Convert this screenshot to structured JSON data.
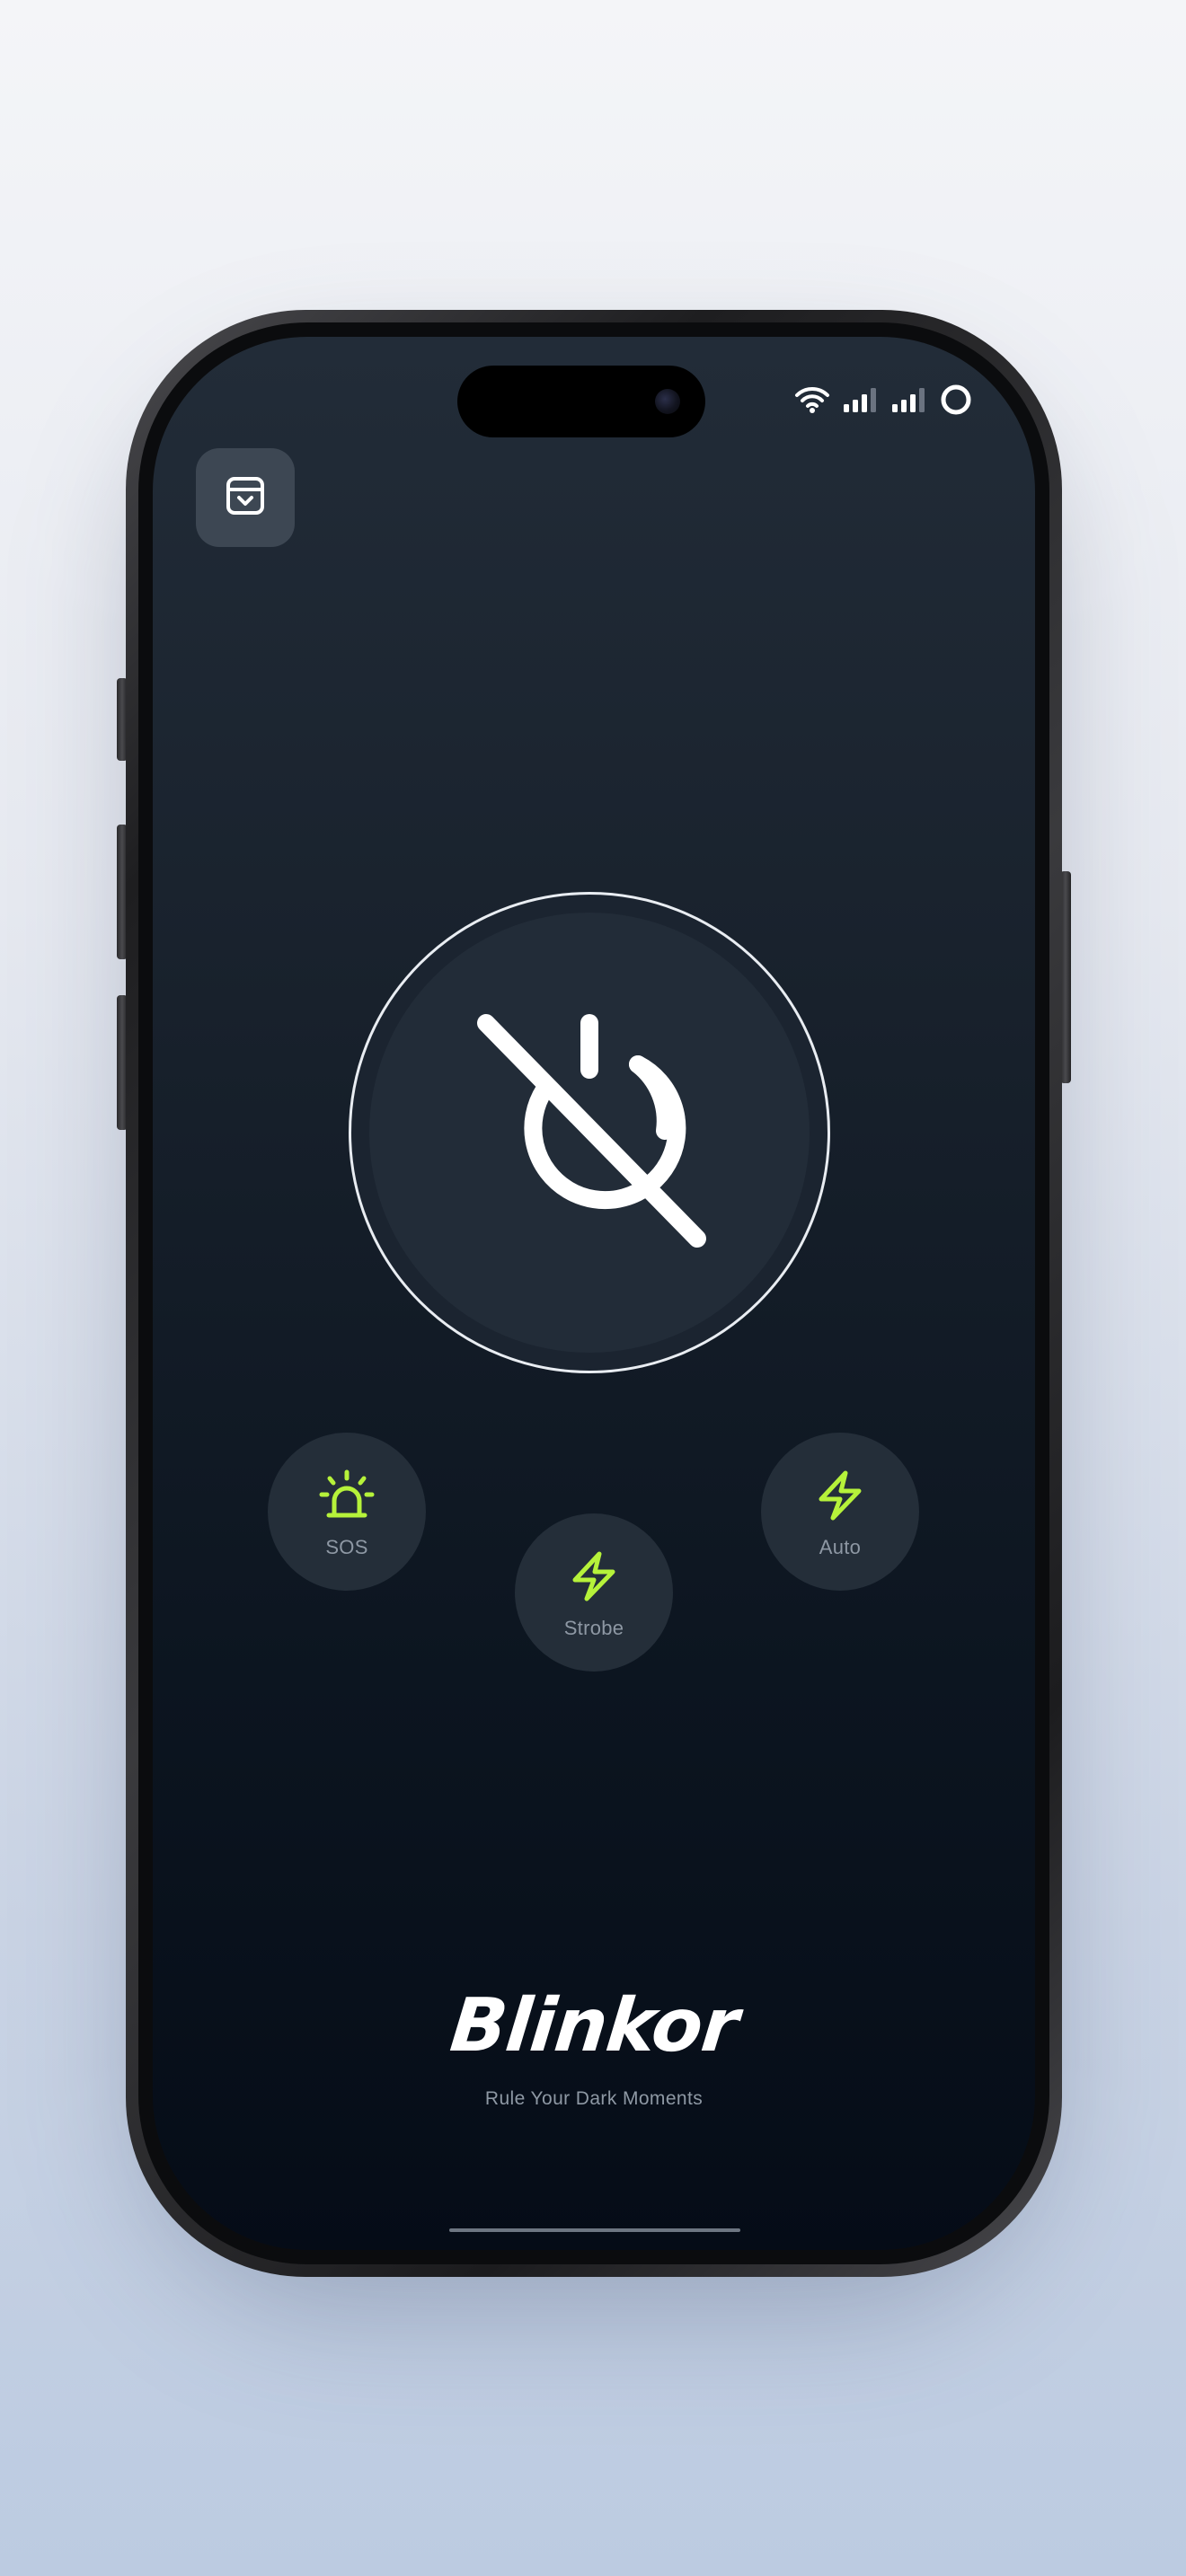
{
  "status_bar": {
    "icons": [
      "wifi-icon",
      "cellular-signal-icon",
      "cellular-signal-icon",
      "battery-ring-icon"
    ]
  },
  "toolbar": {
    "collapse_icon": "tray-chevron-down-icon"
  },
  "power_button": {
    "icon": "power-off-icon",
    "state": "off"
  },
  "modes": [
    {
      "label": "SOS",
      "icon": "siren-icon"
    },
    {
      "label": "Strobe",
      "icon": "lightning-icon"
    },
    {
      "label": "Auto",
      "icon": "lightning-icon"
    }
  ],
  "brand": {
    "name": "Blinkor",
    "tagline": "Rule Your Dark Moments"
  },
  "colors": {
    "accent": "#b6f23a",
    "screen_top": "#222c38",
    "screen_bottom": "#050c17",
    "button_bg": "#242e39",
    "label": "#8e98a4"
  }
}
